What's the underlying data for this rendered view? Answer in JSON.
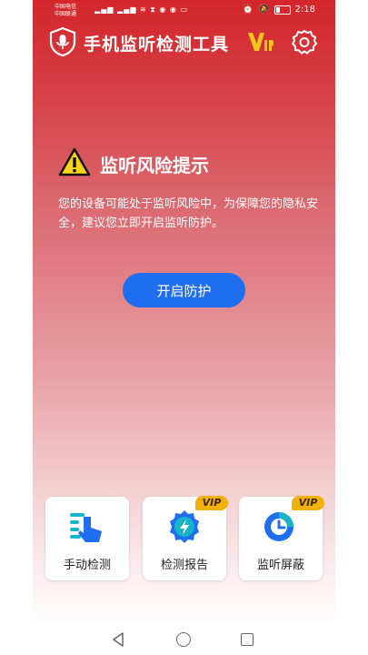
{
  "status_bar": {
    "carrier1": "中国电信",
    "carrier2": "中国联通",
    "time": "2:18"
  },
  "header": {
    "title": "手机监听检测工具",
    "vip_label": "VIP"
  },
  "alert": {
    "title": "监听风险提示",
    "message": "您的设备可能处于监听风险中，为保障您的隐私安全，建议您立即开启监听防护。",
    "button_label": "开启防护"
  },
  "features": [
    {
      "label": "手动检测",
      "icon": "hand-tap-icon",
      "vip": false
    },
    {
      "label": "检测报告",
      "icon": "shield-bolt-icon",
      "vip": true,
      "vip_label": "VIP"
    },
    {
      "label": "监听屏蔽",
      "icon": "clock-shield-icon",
      "vip": true,
      "vip_label": "VIP"
    }
  ],
  "colors": {
    "header_red": "#d3262b",
    "button_blue": "#1f6eef",
    "vip_gold": "#f2b10a"
  }
}
